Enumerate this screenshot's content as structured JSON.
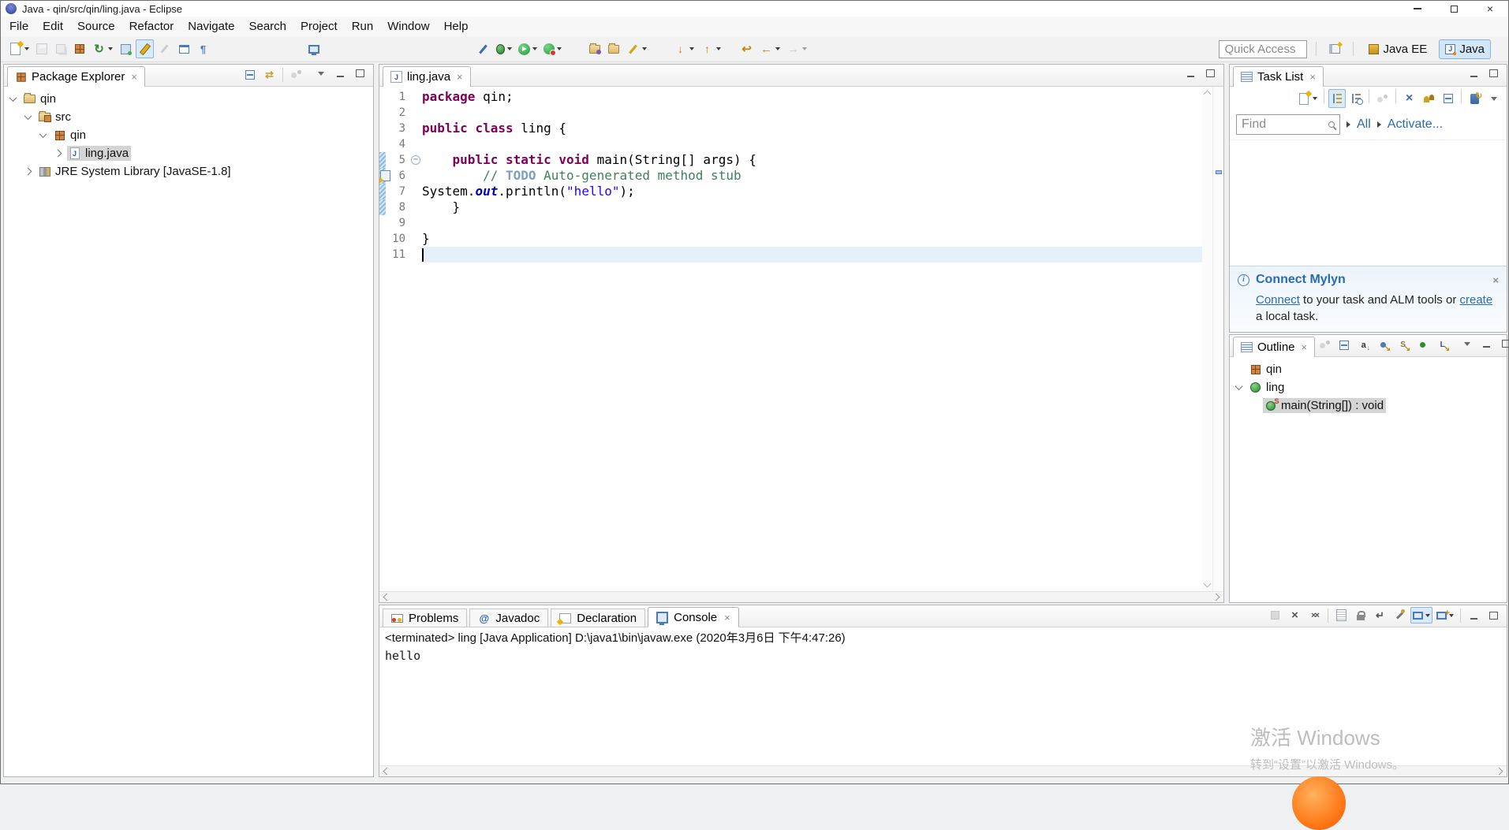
{
  "window": {
    "title": "Java - qin/src/qin/ling.java - Eclipse"
  },
  "menu_items": [
    "File",
    "Edit",
    "Source",
    "Refactor",
    "Navigate",
    "Search",
    "Project",
    "Run",
    "Window",
    "Help"
  ],
  "toolbar": {
    "quick_access": "Quick Access",
    "perspective_java_ee": "Java EE",
    "perspective_java": "Java",
    "main_icons": [
      {
        "name": "new-wizard",
        "kind": "k-page-star",
        "dd": true
      },
      {
        "name": "save",
        "kind": "k-floppy",
        "disabled": true
      },
      {
        "name": "save-all",
        "kind": "k-floppy-all",
        "disabled": true
      },
      {
        "name": "new-java-package",
        "kind": "k-crate"
      },
      {
        "name": "build-all",
        "kind": "k-refresh",
        "dd": true
      },
      {
        "name": "new-java-ee-resource",
        "kind": "k-teamish"
      },
      {
        "name": "search",
        "kind": "k-flash",
        "pressed": true
      },
      {
        "name": "mark-occurrences",
        "kind": "k-pen-gray",
        "disabled": true
      },
      {
        "name": "open-view",
        "kind": "k-panel"
      },
      {
        "name": "show-whitespace",
        "kind": "k-para"
      },
      {
        "space": 116
      },
      {
        "name": "console-view",
        "kind": "k-monitor"
      },
      {
        "space": 190
      },
      {
        "name": "skip-all-breakpoints",
        "kind": "k-pen-blue"
      },
      {
        "name": "debug",
        "kind": "k-bug",
        "dd": true
      },
      {
        "name": "run",
        "kind": "k-run",
        "dd": true
      },
      {
        "name": "run-external-tools",
        "kind": "k-profile",
        "dd": true
      },
      {
        "space": 26
      },
      {
        "name": "open-task",
        "kind": "k-folder-dot"
      },
      {
        "name": "open-task-repository",
        "kind": "k-folder"
      },
      {
        "name": "highlight",
        "kind": "k-pen-gold",
        "dd": true
      },
      {
        "space": 26
      },
      {
        "name": "next-annotation",
        "kind": "k-ar-down",
        "dd": true
      },
      {
        "name": "previous-annotation",
        "kind": "k-ar-up",
        "dd": true
      },
      {
        "space": 16
      },
      {
        "name": "last-edit-location",
        "kind": "k-ar-last"
      },
      {
        "name": "back",
        "kind": "k-ar-back",
        "dd": true
      },
      {
        "name": "forward",
        "kind": "k-ar-fwd",
        "dd": true,
        "disabled": true
      }
    ]
  },
  "package_explorer": {
    "title": "Package Explorer",
    "header_icons": [
      {
        "name": "collapse-all",
        "kind": "k-collapse"
      },
      {
        "name": "link-with-editor",
        "kind": "k-link"
      },
      {
        "sep": true
      },
      {
        "name": "focus-on-active-task",
        "kind": "k-focus",
        "disabled": true
      }
    ],
    "corner_icons": [
      {
        "name": "view-menu",
        "kind": "k-vmenu"
      },
      {
        "name": "minimize",
        "kind": "k-min"
      },
      {
        "name": "maximize",
        "kind": "k-max"
      }
    ],
    "tree": [
      {
        "label": "qin",
        "level": 0,
        "icon": "project",
        "expander": "open"
      },
      {
        "label": "src",
        "level": 1,
        "icon": "src-folder",
        "expander": "open"
      },
      {
        "label": "qin",
        "level": 2,
        "icon": "package",
        "expander": "open"
      },
      {
        "label": "ling.java",
        "level": 3,
        "icon": "java-file",
        "expander": "closed",
        "selected": true
      },
      {
        "label": "JRE System Library [JavaSE-1.8]",
        "level": 1,
        "icon": "library",
        "expander": "closed"
      }
    ]
  },
  "editor": {
    "tab_label": "ling.java",
    "corner_icons": [
      {
        "name": "minimize",
        "kind": "k-min"
      },
      {
        "name": "maximize",
        "kind": "k-max"
      }
    ],
    "lines": [
      {
        "n": 1,
        "tokens": [
          {
            "t": "package",
            "c": "kw"
          },
          {
            "t": " qin;",
            "c": "pl"
          }
        ]
      },
      {
        "n": 2,
        "tokens": []
      },
      {
        "n": 3,
        "tokens": [
          {
            "t": "public",
            "c": "kw"
          },
          {
            "t": " ",
            "c": "pl"
          },
          {
            "t": "class",
            "c": "kw"
          },
          {
            "t": " ling {",
            "c": "pl"
          }
        ]
      },
      {
        "n": 4,
        "tokens": []
      },
      {
        "n": 5,
        "fold": true,
        "changed": true,
        "tokens": [
          {
            "t": "    ",
            "c": "pl"
          },
          {
            "t": "public",
            "c": "kw"
          },
          {
            "t": " ",
            "c": "pl"
          },
          {
            "t": "static",
            "c": "kw"
          },
          {
            "t": " ",
            "c": "pl"
          },
          {
            "t": "void",
            "c": "kw"
          },
          {
            "t": " main(String[] args) {",
            "c": "pl"
          }
        ]
      },
      {
        "n": 6,
        "changed": true,
        "task": true,
        "tokens": [
          {
            "t": "        ",
            "c": "pl"
          },
          {
            "t": "// ",
            "c": "cm"
          },
          {
            "t": "TODO",
            "c": "todo"
          },
          {
            "t": " Auto-generated method stub",
            "c": "cm"
          }
        ]
      },
      {
        "n": 7,
        "changed": true,
        "tokens": [
          {
            "t": "System.",
            "c": "pl"
          },
          {
            "t": "out",
            "c": "fld"
          },
          {
            "t": ".println(",
            "c": "pl"
          },
          {
            "t": "\"hello\"",
            "c": "str"
          },
          {
            "t": ");",
            "c": "pl"
          }
        ]
      },
      {
        "n": 8,
        "changed": true,
        "tokens": [
          {
            "t": "    }",
            "c": "pl"
          }
        ]
      },
      {
        "n": 9,
        "tokens": []
      },
      {
        "n": 10,
        "tokens": [
          {
            "t": "}",
            "c": "pl"
          }
        ]
      },
      {
        "n": 11,
        "current": true,
        "cursor": true,
        "tokens": []
      }
    ]
  },
  "task_list": {
    "title": "Task List",
    "find_placeholder": "Find",
    "all_label": "All",
    "activate_label": "Activate...",
    "toolbar_icons": [
      {
        "name": "new-task",
        "kind": "k-newtask",
        "dd": true
      },
      {
        "sep": true
      },
      {
        "name": "categorized",
        "kind": "k-cat",
        "pressed": true
      },
      {
        "name": "scheduled",
        "kind": "k-sched"
      },
      {
        "sep": true
      },
      {
        "name": "focus-on-workweek",
        "kind": "k-focus",
        "disabled": true
      },
      {
        "sep": true
      },
      {
        "name": "hide-completed-tasks",
        "kind": "k-xslash"
      },
      {
        "name": "my-tasks",
        "kind": "k-people"
      },
      {
        "name": "collapse-all",
        "kind": "k-collapse"
      },
      {
        "sep": true
      },
      {
        "name": "synchronize",
        "kind": "k-sync"
      },
      {
        "name": "view-menu",
        "kind": "k-vmenu"
      }
    ],
    "corner_icons": [
      {
        "name": "minimize",
        "kind": "k-min"
      },
      {
        "name": "maximize",
        "kind": "k-max"
      }
    ]
  },
  "mylyn": {
    "title": "Connect Mylyn",
    "link_connect": "Connect",
    "text_mid": " to your task and ALM tools or ",
    "link_create": "create",
    "text_end": " a local task."
  },
  "outline": {
    "title": "Outline",
    "toolbar_icons": [
      {
        "name": "focus-on-active-task",
        "kind": "k-focus",
        "disabled": true
      },
      {
        "name": "collapse-all",
        "kind": "k-collapse"
      },
      {
        "name": "sort",
        "kind": "k-sort"
      },
      {
        "name": "hide-fields",
        "kind": "k-hide-f"
      },
      {
        "name": "hide-static-members",
        "kind": "k-hide-s"
      },
      {
        "name": "hide-non-public-members",
        "kind": "k-hide-p"
      },
      {
        "name": "hide-local-types",
        "kind": "k-hide-l"
      }
    ],
    "corner_icons": [
      {
        "name": "view-menu",
        "kind": "k-vmenu"
      },
      {
        "name": "minimize",
        "kind": "k-min"
      },
      {
        "name": "maximize",
        "kind": "k-max"
      }
    ],
    "items": [
      {
        "label": "qin",
        "level": 0,
        "icon": "package",
        "expander": "none"
      },
      {
        "label": "ling",
        "level": 0,
        "icon": "class",
        "expander": "open"
      },
      {
        "label": "main(String[]) : void",
        "level": 1,
        "icon": "method-static",
        "expander": "none",
        "selected": true
      }
    ]
  },
  "bottom": {
    "tabs": [
      {
        "label": "Problems",
        "icon": "problems"
      },
      {
        "label": "Javadoc",
        "icon": "javadoc"
      },
      {
        "label": "Declaration",
        "icon": "declaration"
      },
      {
        "label": "Console",
        "icon": "console",
        "active": true
      }
    ],
    "toolbar_icons": [
      {
        "name": "terminate",
        "kind": "k-term",
        "disabled": true
      },
      {
        "name": "remove-launch",
        "kind": "k-x"
      },
      {
        "name": "remove-all-terminated-launches",
        "kind": "k-xx"
      },
      {
        "sep": true
      },
      {
        "name": "clear-console",
        "kind": "k-clear"
      },
      {
        "name": "scroll-lock",
        "kind": "k-lock"
      },
      {
        "name": "word-wrap",
        "kind": "k-wrap"
      },
      {
        "name": "pin-console",
        "kind": "k-pin"
      },
      {
        "name": "display-selected-console",
        "kind": "k-disp",
        "dd": true,
        "pressed": true
      },
      {
        "name": "open-console",
        "kind": "k-open-con",
        "dd": true
      },
      {
        "sep": true
      },
      {
        "name": "minimize",
        "kind": "k-min"
      },
      {
        "name": "maximize",
        "kind": "k-max"
      }
    ],
    "console_status": "<terminated> ling [Java Application] D:\\java1\\bin\\javaw.exe (2020年3月6日 下午4:47:26)",
    "console_output": "hello"
  },
  "watermark": {
    "line1": "激活 Windows",
    "line2": "转到“设置”以激活 Windows。"
  },
  "colors": {
    "keyword": "#7f0055",
    "string": "#2a00ff",
    "comment": "#3f7f5f",
    "todo_tag": "#7f9fbf",
    "static_field": "#0000c0",
    "current_line": "#e6f0fa",
    "selection_gray": "#d4d4d4",
    "link_blue": "#2a6bb0",
    "perspective_active_bg": "#d2e6f8"
  }
}
